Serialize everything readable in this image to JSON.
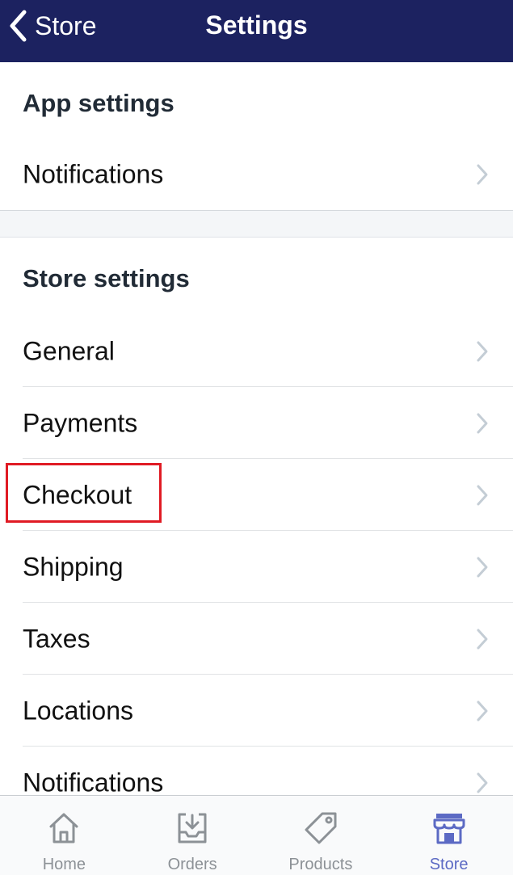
{
  "header": {
    "back_label": "Store",
    "title": "Settings"
  },
  "app_settings": {
    "heading": "App settings",
    "items": [
      {
        "label": "Notifications"
      }
    ]
  },
  "store_settings": {
    "heading": "Store settings",
    "items": [
      {
        "label": "General"
      },
      {
        "label": "Payments"
      },
      {
        "label": "Checkout"
      },
      {
        "label": "Shipping"
      },
      {
        "label": "Taxes"
      },
      {
        "label": "Locations"
      },
      {
        "label": "Notifications"
      }
    ]
  },
  "tabbar": {
    "tabs": [
      {
        "label": "Home",
        "icon": "home-icon",
        "active": false
      },
      {
        "label": "Orders",
        "icon": "orders-inbox-icon",
        "active": false
      },
      {
        "label": "Products",
        "icon": "tag-icon",
        "active": false
      },
      {
        "label": "Store",
        "icon": "storefront-icon",
        "active": true
      }
    ]
  },
  "colors": {
    "navbar": "#1c2260",
    "active_tab": "#5c6ac4",
    "inactive_tab": "#8c9196",
    "highlight": "#e01b24"
  }
}
